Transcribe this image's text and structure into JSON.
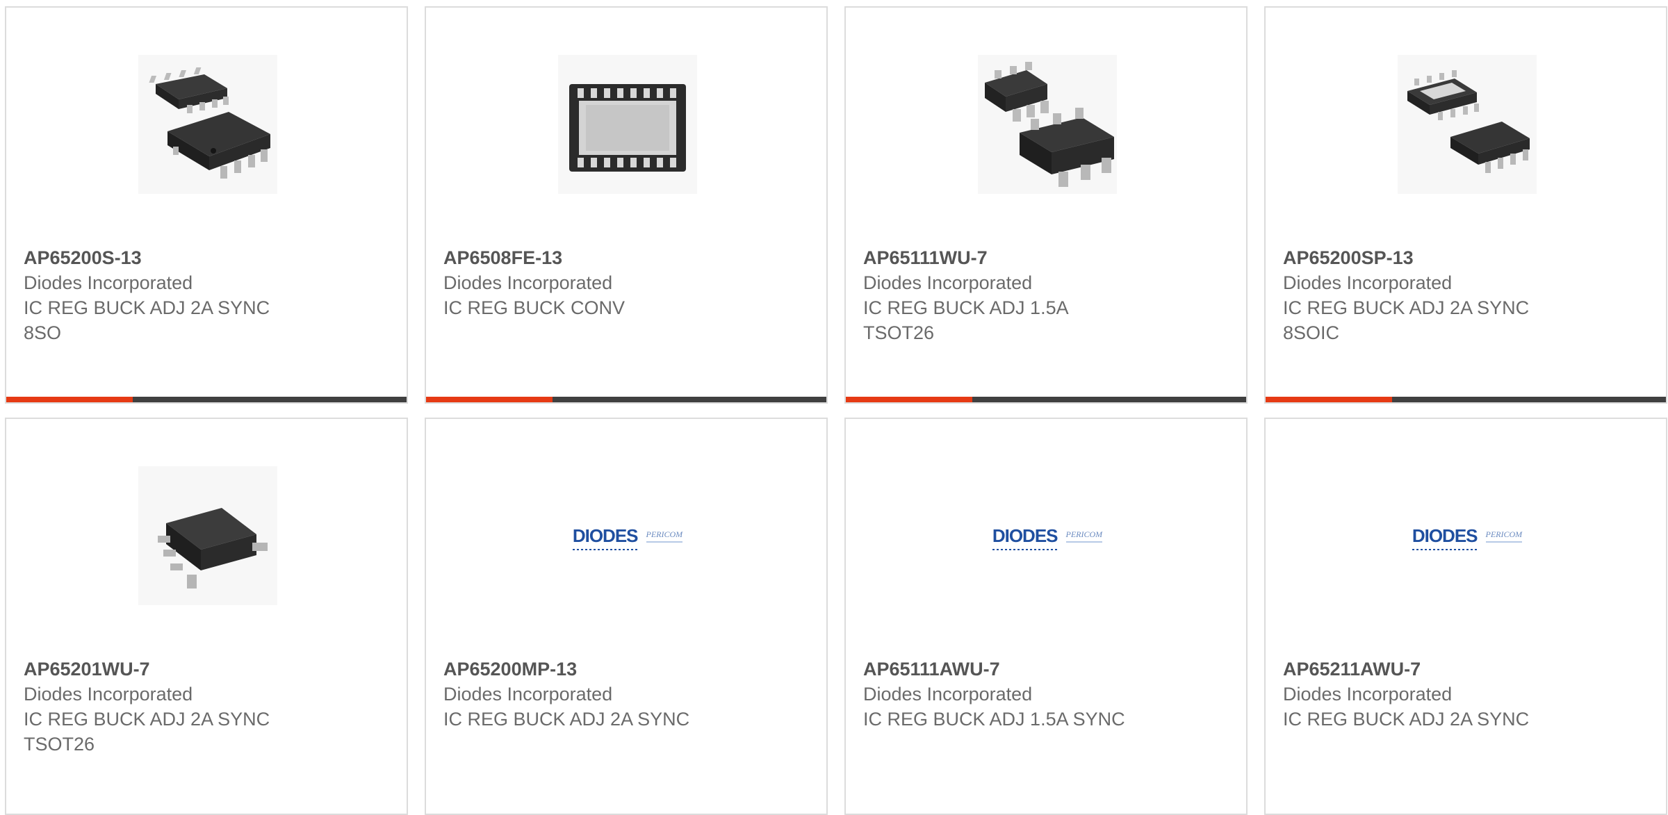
{
  "products": [
    {
      "part_number": "AP65200S-13",
      "manufacturer": "Diodes Incorporated",
      "description_lines": [
        "IC REG BUCK ADJ 2A SYNC",
        "8SO"
      ],
      "image": "so8-package-image"
    },
    {
      "part_number": "AP6508FE-13",
      "manufacturer": "Diodes Incorporated",
      "description_lines": [
        "IC REG BUCK CONV",
        ""
      ],
      "image": "dfn-package-image"
    },
    {
      "part_number": "AP65111WU-7",
      "manufacturer": "Diodes Incorporated",
      "description_lines": [
        "IC REG BUCK ADJ 1.5A TSOT26",
        ""
      ],
      "image": "tsot26-pair-image"
    },
    {
      "part_number": "AP65200SP-13",
      "manufacturer": "Diodes Incorporated",
      "description_lines": [
        "IC REG BUCK ADJ 2A SYNC",
        "8SOIC"
      ],
      "image": "soic8-pad-image"
    },
    {
      "part_number": "AP65201WU-7",
      "manufacturer": "Diodes Incorporated",
      "description_lines": [
        "IC REG BUCK ADJ 2A SYNC",
        "TSOT26"
      ],
      "image": "tsot26-image"
    },
    {
      "part_number": "AP65200MP-13",
      "manufacturer": "Diodes Incorporated",
      "description_lines": [
        "IC REG BUCK ADJ 2A SYNC",
        ""
      ],
      "image": "diodes-pericom-logo"
    },
    {
      "part_number": "AP65111AWU-7",
      "manufacturer": "Diodes Incorporated",
      "description_lines": [
        "IC REG BUCK ADJ 1.5A SYNC",
        ""
      ],
      "image": "diodes-pericom-logo"
    },
    {
      "part_number": "AP65211AWU-7",
      "manufacturer": "Diodes Incorporated",
      "description_lines": [
        "IC REG BUCK ADJ 2A SYNC",
        ""
      ],
      "image": "diodes-pericom-logo"
    }
  ],
  "logo": {
    "brand": "DIODES",
    "sub": "PERICOM"
  },
  "colors": {
    "accent": "#e63a14",
    "bar": "#404040",
    "part_number": "#555555",
    "text": "#6a6a6a",
    "logo_blue": "#1f4fa0"
  }
}
